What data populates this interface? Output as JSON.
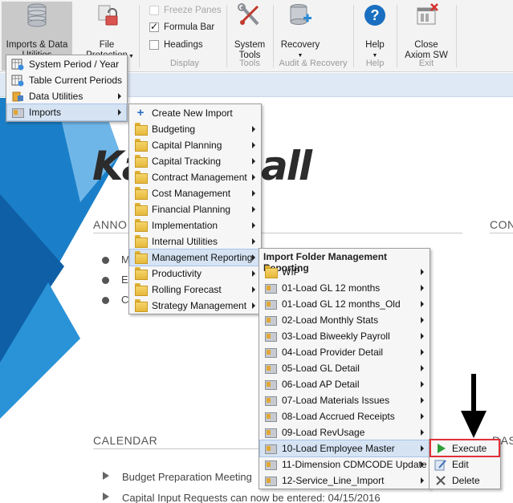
{
  "ribbon": {
    "imports_utilities_label": "Imports & Data Utilities",
    "file_protection_label": "File Protection",
    "freeze_panes_label": "Freeze Panes",
    "formula_bar_label": "Formula Bar",
    "headings_label": "Headings",
    "display_group": "Display",
    "system_tools_label": "System Tools",
    "tools_group": "Tools",
    "recovery_label": "Recovery",
    "audit_recovery_group": "Audit & Recovery",
    "help_label": "Help",
    "help_group": "Help",
    "close_label": "Close Axiom SW",
    "exit_group": "Exit"
  },
  "background": {
    "logo_left": "Ka",
    "logo_right": "all",
    "announcements_partial": "ANNO",
    "contacts_partial": "CON",
    "calendar_title": "CALENDAR",
    "dash_partial": "DAS",
    "bullets_partial": [
      "M",
      "E",
      "C"
    ],
    "calendar_items": [
      "Budget Preparation Meeting",
      "Capital Input Requests can now be entered: 04/15/2016"
    ]
  },
  "menu1": {
    "items": [
      {
        "label": "System Period / Year"
      },
      {
        "label": "Table Current Periods"
      },
      {
        "label": "Data Utilities"
      },
      {
        "label": "Imports"
      }
    ]
  },
  "menu2": {
    "items": [
      {
        "label": "Create New Import"
      },
      {
        "label": "Budgeting"
      },
      {
        "label": "Capital Planning"
      },
      {
        "label": "Capital Tracking"
      },
      {
        "label": "Contract Management"
      },
      {
        "label": "Cost Management"
      },
      {
        "label": "Financial Planning"
      },
      {
        "label": "Implementation"
      },
      {
        "label": "Internal Utilities"
      },
      {
        "label": "Management Reporting"
      },
      {
        "label": "Productivity"
      },
      {
        "label": "Rolling Forecast"
      },
      {
        "label": "Strategy Management"
      }
    ]
  },
  "menu3": {
    "header": "Import Folder Management Reporting",
    "items": [
      {
        "label": "WIP"
      },
      {
        "label": "01-Load GL 12 months"
      },
      {
        "label": "01-Load GL 12 months_Old"
      },
      {
        "label": "02-Load Monthly Stats"
      },
      {
        "label": "03-Load Biweekly Payroll"
      },
      {
        "label": "04-Load Provider Detail"
      },
      {
        "label": "05-Load GL Detail"
      },
      {
        "label": "06-Load AP Detail"
      },
      {
        "label": "07-Load Materials Issues"
      },
      {
        "label": "08-Load Accrued Receipts"
      },
      {
        "label": "09-Load RevUsage"
      },
      {
        "label": "10-Load Employee Master"
      },
      {
        "label": "11-Dimension CDMCODE Update"
      },
      {
        "label": "12-Service_Line_Import"
      }
    ]
  },
  "menu4": {
    "items": [
      {
        "label": "Execute"
      },
      {
        "label": "Edit"
      },
      {
        "label": "Delete"
      }
    ]
  },
  "colors": {
    "highlight": "#d5e3f3",
    "execute_box": "#e0303a",
    "brand_blue": "#1a7fc8"
  }
}
